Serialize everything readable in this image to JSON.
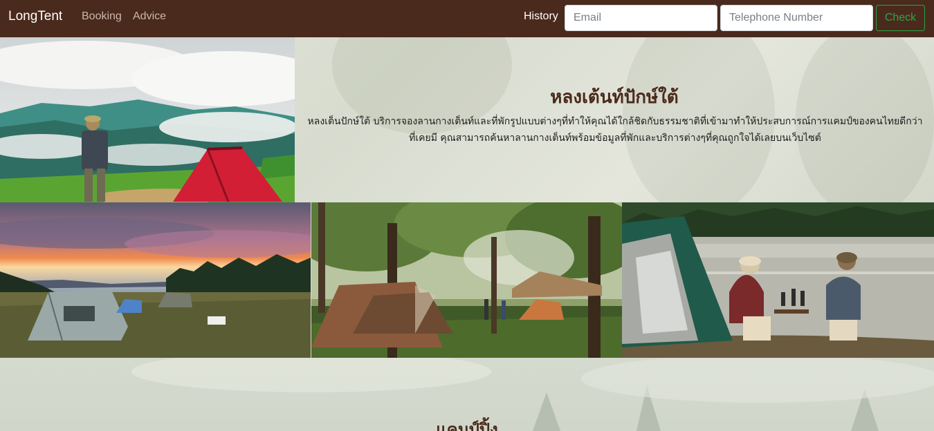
{
  "navbar": {
    "brand": "LongTent",
    "links": [
      "Booking",
      "Advice"
    ],
    "history_label": "History",
    "email_placeholder": "Email",
    "phone_placeholder": "Telephone Number",
    "check_label": "Check"
  },
  "hero": {
    "title": "หลงเต้นท์ปักษ์ใต้",
    "description": "หลงเต็นปักษ์ใต้ บริการจองลานกางเต็นท์และที่พักรูปแบบต่างๆที่ทำให้คุณได้ใกล้ชิดกับธรรมชาติที่เข้ามาทำให้ประสบการณ์การแคมป์ของคนไทยดีกว่าที่เคยมี คุณสามารถค้นหาลานกางเต็นท์พร้อมข้อมูลที่พักและบริการต่างๆที่คุณถูกใจได้เลยบนเว็บไซต์"
  },
  "section": {
    "title": "แคมป์ปิ้ง"
  },
  "colors": {
    "navbar_bg": "#4a2a1c",
    "title_color": "#4a2a1c",
    "check_accent": "#28a745"
  }
}
